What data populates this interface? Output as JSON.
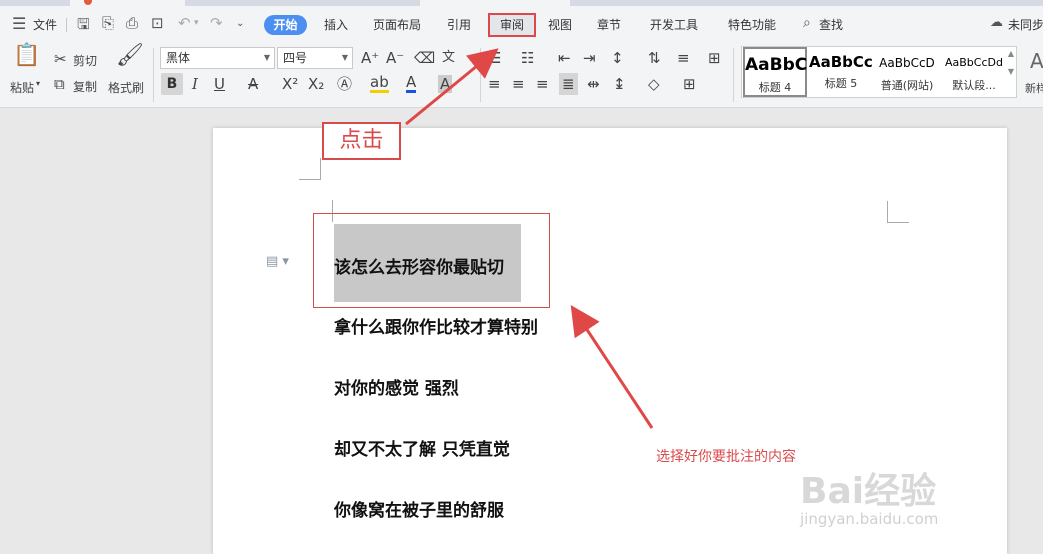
{
  "menu": {
    "file_label": "文件",
    "tabs": [
      "开始",
      "插入",
      "页面布局",
      "引用",
      "审阅",
      "视图",
      "章节",
      "开发工具",
      "特色功能"
    ],
    "search_label": "查找",
    "sync_label": "未同步"
  },
  "ribbon": {
    "paste_label": "粘贴",
    "cut_label": "剪切",
    "copy_label": "复制",
    "format_painter_label": "格式刷",
    "font_name": "黑体",
    "font_size": "四号",
    "styles": [
      {
        "sample": "AaBbC",
        "name": "标题 4"
      },
      {
        "sample": "AaBbCcl",
        "name": "标题 5"
      },
      {
        "sample": "AaBbCcD",
        "name": "普通(网站)"
      },
      {
        "sample": "AaBbCcDd",
        "name": "默认段..."
      }
    ],
    "new_style_label": "新样"
  },
  "document": {
    "lines": [
      "该怎么去形容你最贴切",
      "拿什么跟你作比较才算特别",
      "对你的感觉  强烈",
      "却又不太了解  只凭直觉",
      "你像窝在被子里的舒服"
    ]
  },
  "annotations": {
    "click_label": "点击",
    "select_note": "选择好你要批注的内容"
  },
  "watermark": {
    "brand": "Bai经验",
    "url": "jingyan.baidu.com"
  },
  "colors": {
    "accent": "#4d8ff0",
    "annotation": "#d94b4b"
  }
}
